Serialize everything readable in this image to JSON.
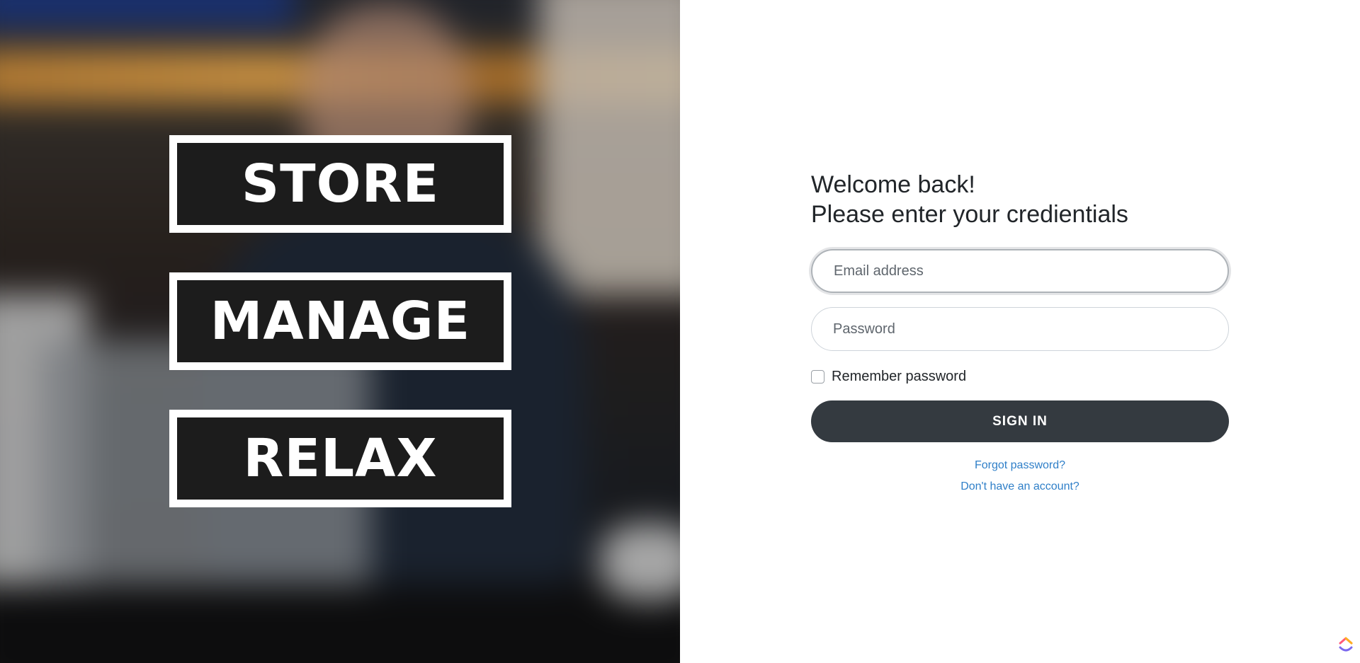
{
  "hero": {
    "words": [
      "STORE",
      "MANAGE",
      "RELAX"
    ]
  },
  "form": {
    "welcome": "Welcome back!",
    "subtitle": "Please enter your credientials",
    "email_placeholder": "Email address",
    "password_placeholder": "Password",
    "remember_label": "Remember password",
    "remember_checked": false,
    "signin_label": "SIGN IN",
    "forgot_link": "Forgot password?",
    "signup_link": "Don't have an account?"
  },
  "icons": {
    "corner": "clickup-logo-icon"
  },
  "colors": {
    "button_bg": "#343a40",
    "link": "#2f7fc8",
    "word_box_bg": "#1c1c1c"
  }
}
